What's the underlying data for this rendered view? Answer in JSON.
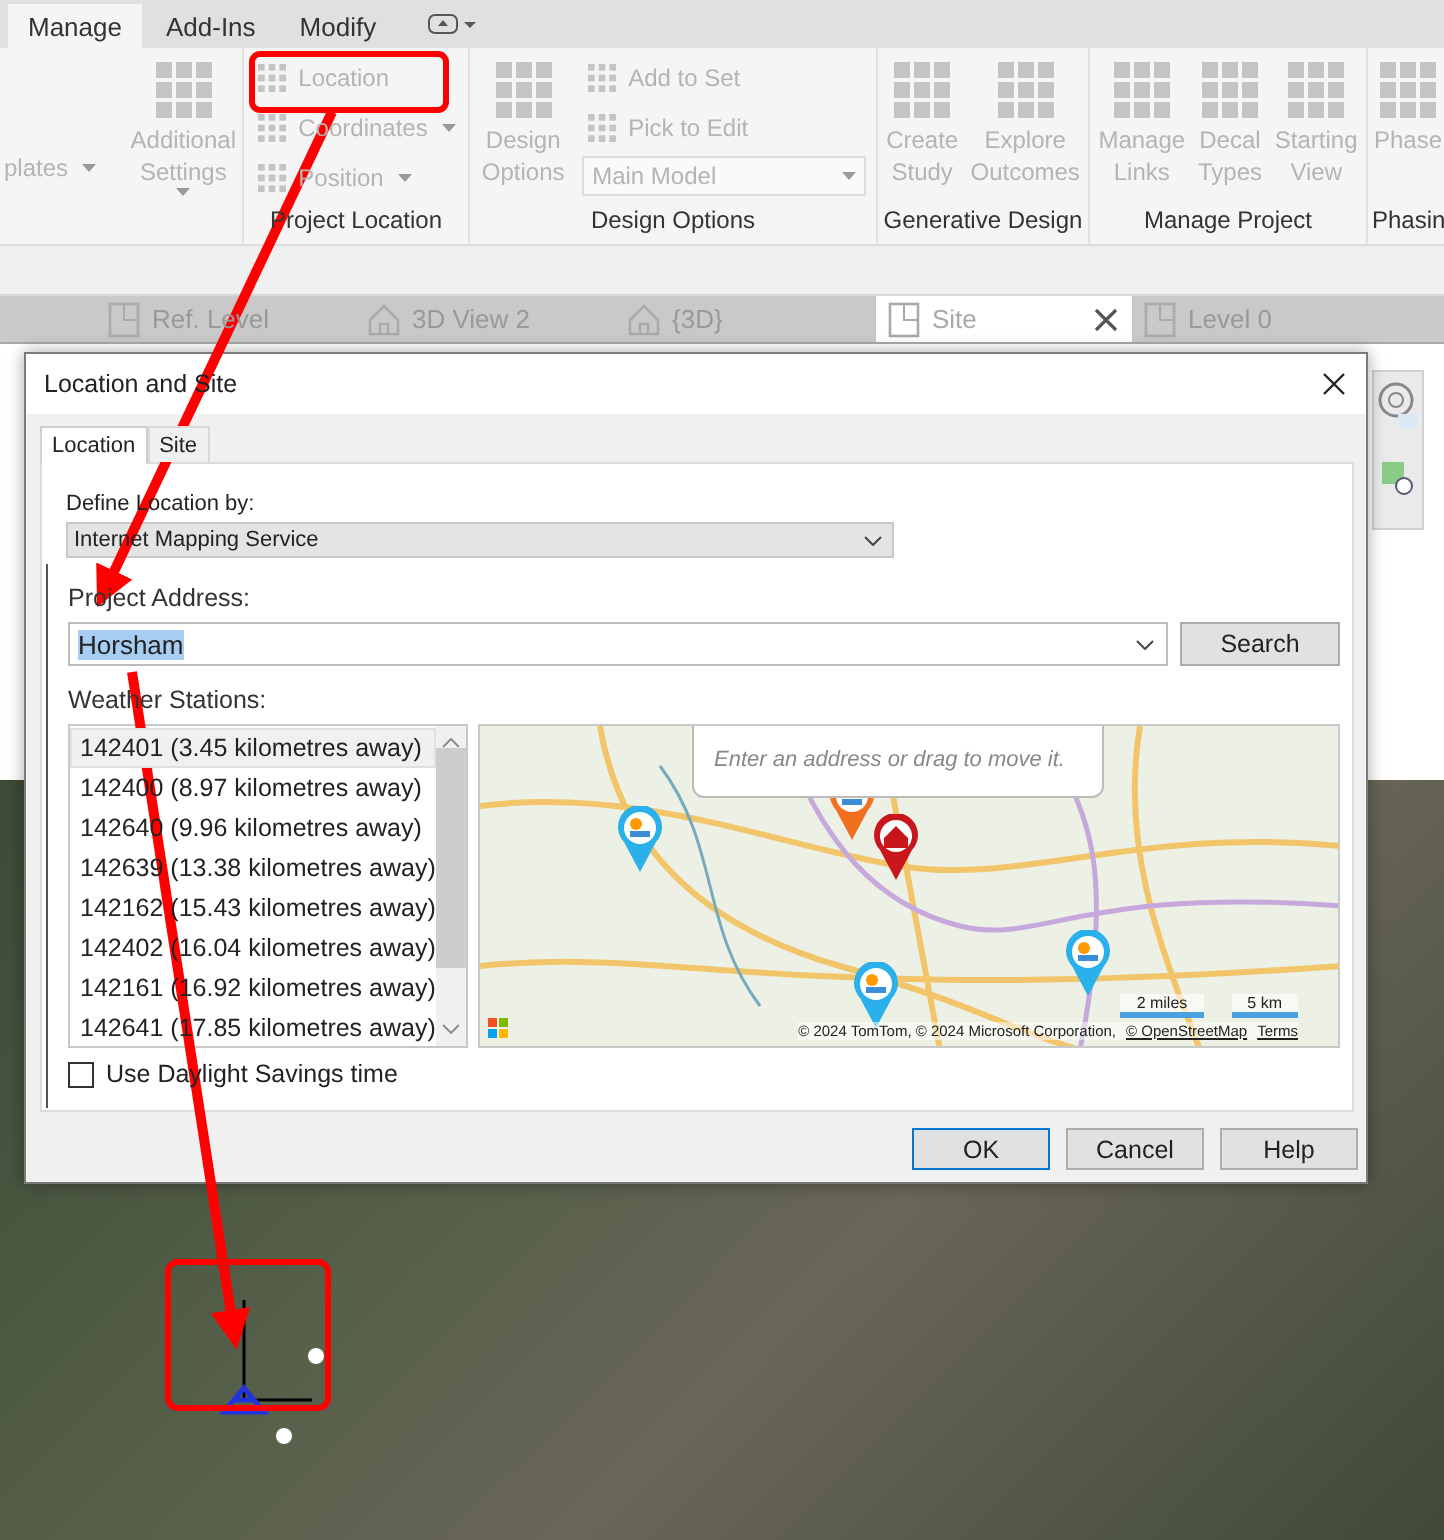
{
  "ribbon": {
    "tabs": [
      {
        "label": "Manage",
        "selected": true
      },
      {
        "label": "Add-Ins",
        "selected": false
      },
      {
        "label": "Modify",
        "selected": false
      }
    ],
    "groups": [
      {
        "columns": [
          {
            "kind": "stack",
            "items": [
              {
                "kind": "text",
                "label": "plates",
                "dropdown": true,
                "disabled": true
              }
            ]
          },
          {
            "kind": "large",
            "label": "Additional Settings",
            "dropdown": true,
            "disabled": true
          }
        ]
      },
      {
        "label": "Project Location",
        "columns": [
          {
            "kind": "stack",
            "items": [
              {
                "kind": "small",
                "label": "Location",
                "dropdown": false,
                "disabled": true
              },
              {
                "kind": "small",
                "label": "Coordinates",
                "dropdown": true,
                "disabled": true
              },
              {
                "kind": "small",
                "label": "Position",
                "dropdown": true,
                "disabled": true
              }
            ]
          }
        ]
      },
      {
        "label": "Design Options",
        "columns": [
          {
            "kind": "large",
            "label": "Design Options",
            "dropdown": false,
            "disabled": true
          },
          {
            "kind": "stack",
            "items": [
              {
                "kind": "small",
                "label": "Add to Set",
                "dropdown": false,
                "disabled": true
              },
              {
                "kind": "small",
                "label": "Pick to Edit",
                "dropdown": false,
                "disabled": true
              },
              {
                "kind": "combo",
                "label": "Main Model",
                "dropdown": true,
                "disabled": true
              }
            ]
          }
        ]
      },
      {
        "label": "Generative Design",
        "columns": [
          {
            "kind": "large",
            "label": "Create Study",
            "dropdown": false,
            "disabled": true
          },
          {
            "kind": "large",
            "label": "Explore Outcomes",
            "dropdown": false,
            "disabled": true
          }
        ]
      },
      {
        "label": "Manage Project",
        "columns": [
          {
            "kind": "large",
            "label": "Manage Links",
            "dropdown": false,
            "disabled": true
          },
          {
            "kind": "large",
            "label": "Decal Types",
            "dropdown": false,
            "disabled": true
          },
          {
            "kind": "large",
            "label": "Starting View",
            "dropdown": false,
            "disabled": true
          }
        ]
      },
      {
        "label": "Phasin",
        "columns": [
          {
            "kind": "large",
            "label": "Phase",
            "dropdown": false,
            "disabled": true
          }
        ]
      }
    ]
  },
  "view_tabs": [
    {
      "label": "Ref. Level",
      "kind": "plan",
      "selected": false
    },
    {
      "label": "3D View 2",
      "kind": "model",
      "selected": false
    },
    {
      "label": "{3D}",
      "kind": "model",
      "selected": false
    },
    {
      "label": "Site",
      "kind": "plan",
      "selected": true
    },
    {
      "label": "Level 0",
      "kind": "plan",
      "selected": false
    }
  ],
  "dialog": {
    "title": "Location and Site",
    "tabs": [
      {
        "label": "Location",
        "selected": true
      },
      {
        "label": "Site",
        "selected": false
      }
    ],
    "define_label": "Define Location by:",
    "define_value": "Internet Mapping Service",
    "address_label": "Project Address:",
    "address_value": "Horsham",
    "address_text_selected": true,
    "search_button": "Search",
    "stations_label": "Weather Stations:",
    "stations": [
      {
        "label": "142401 (3.45 kilometres away)",
        "selected": true
      },
      {
        "label": "142400 (8.97 kilometres away)",
        "selected": false
      },
      {
        "label": "142640 (9.96 kilometres away)",
        "selected": false
      },
      {
        "label": "142639 (13.38 kilometres away)",
        "selected": false
      },
      {
        "label": "142162 (15.43 kilometres away)",
        "selected": false
      },
      {
        "label": "142402 (16.04 kilometres away)",
        "selected": false
      },
      {
        "label": "142161 (16.92 kilometres away)",
        "selected": false
      },
      {
        "label": "142641 (17.85 kilometres away)",
        "selected": false
      }
    ],
    "map": {
      "popup_hint": "Enter an address or drag to move it.",
      "scale": [
        "2 miles",
        "5 km"
      ],
      "attribution": "© 2024 TomTom, © 2024 Microsoft Corporation,",
      "links": [
        "© OpenStreetMap",
        "Terms"
      ]
    },
    "daylight_savings": {
      "label": "Use Daylight Savings time",
      "checked": false
    },
    "buttons": [
      {
        "label": "OK",
        "default": true
      },
      {
        "label": "Cancel",
        "default": false
      },
      {
        "label": "Help",
        "default": false
      }
    ]
  }
}
